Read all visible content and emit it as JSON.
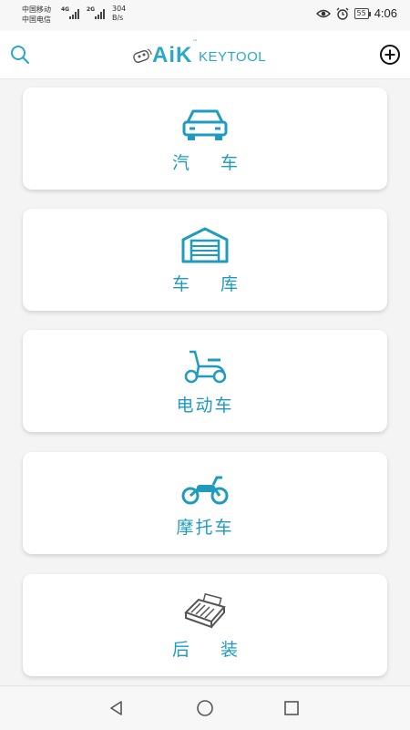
{
  "status_bar": {
    "carrier_1": "中国移动",
    "carrier_2": "中国电信",
    "net_1": "4G",
    "net_2": "2G",
    "speed_value": "304",
    "speed_unit": "B/s",
    "battery": "55",
    "time": "4:06"
  },
  "header": {
    "logo_brand": "AiK",
    "logo_tm": "™",
    "logo_product": "KEYTOOL",
    "search_icon": "search-icon",
    "add_icon": "plus-circle-icon"
  },
  "categories": [
    {
      "label": "汽 车",
      "icon": "car-icon"
    },
    {
      "label": "车 库",
      "icon": "garage-icon"
    },
    {
      "label": "电动车",
      "icon": "scooter-icon"
    },
    {
      "label": "摩托车",
      "icon": "motorcycle-icon"
    },
    {
      "label": "后 装",
      "icon": "remote-module-icon"
    }
  ],
  "colors": {
    "accent": "#1e9bbf",
    "background": "#f4f4f4",
    "card": "#ffffff"
  },
  "nav": {
    "back_icon": "back-triangle-icon",
    "home_icon": "home-circle-icon",
    "recents_icon": "recents-square-icon"
  }
}
